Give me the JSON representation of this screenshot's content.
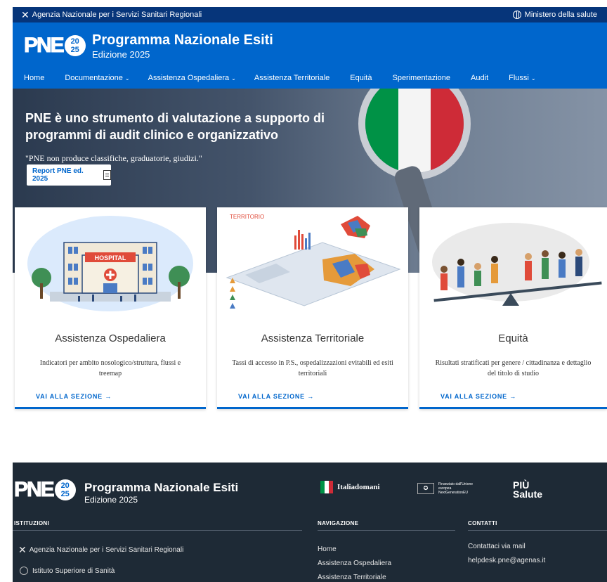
{
  "topbar": {
    "agency": "Agenzia Nazionale per i Servizi Sanitari Regionali",
    "ministry": "Ministero della salute"
  },
  "logo": {
    "text": "PNE",
    "year_top": "20",
    "year_bottom": "25"
  },
  "header": {
    "title": "Programma Nazionale Esiti",
    "subtitle": "Edizione 2025"
  },
  "nav": {
    "items": [
      {
        "label": "Home",
        "chevron": ""
      },
      {
        "label": "Documentazione",
        "chevron": "⌄"
      },
      {
        "label": "Assistenza Ospedaliera",
        "chevron": "⌄"
      },
      {
        "label": "Assistenza Territoriale",
        "chevron": ""
      },
      {
        "label": "Equità",
        "chevron": ""
      },
      {
        "label": "Sperimentazione",
        "chevron": ""
      },
      {
        "label": "Audit",
        "chevron": ""
      },
      {
        "label": "Flussi",
        "chevron": "⌄"
      }
    ]
  },
  "hero": {
    "headline": "PNE è uno strumento di valutazione a supporto di programmi di audit clinico e organizzativo",
    "quote": "\"PNE non produce classifiche, graduatorie, giudizi.\"",
    "button": "Report PNE ed. 2025"
  },
  "cards": [
    {
      "title": "Assistenza Ospedaliera",
      "description": "Indicatori per ambito nosologico/struttura, flussi e treemap",
      "link": "VAI ALLA SEZIONE →",
      "illustration_label": "HOSPITAL"
    },
    {
      "title": "Assistenza Territoriale",
      "description": "Tassi di accesso in P.S., ospedalizzazioni evitabili ed esiti territoriali",
      "link": "VAI ALLA SEZIONE →",
      "illustration_label": "TERRITORIO"
    },
    {
      "title": "Equità",
      "description": "Risultati stratificati per genere / cittadinanza e dettaglio del titolo di studio",
      "link": "VAI ALLA SEZIONE →"
    }
  ],
  "footer": {
    "title": "Programma Nazionale Esiti",
    "subtitle": "Edizione 2025",
    "italiadomani": "Italiadomani",
    "eu_text": "Finanziato dall'Unione europea NextGenerationEU",
    "piu_salute_top": "PIÙ",
    "piu_salute_bottom": "Salute",
    "sections": {
      "istituzioni": {
        "heading": "ISTITUZIONI",
        "items": [
          "Agenzia Nazionale per i Servizi Sanitari Regionali",
          "Istituto Superiore di Sanità"
        ]
      },
      "navigazione": {
        "heading": "NAVIGAZIONE",
        "items": [
          "Home",
          "Assistenza Ospedaliera",
          "Assistenza Territoriale"
        ]
      },
      "contatti": {
        "heading": "CONTATTI",
        "items": [
          "Contattaci via mail",
          "helpdesk.pne@agenas.it"
        ]
      }
    }
  },
  "colors": {
    "topbar": "#06357a",
    "primary": "#0066cc",
    "footer": "#1e2a36",
    "flag_green": "#009246",
    "flag_white": "#ffffff",
    "flag_red": "#ce2b37"
  }
}
